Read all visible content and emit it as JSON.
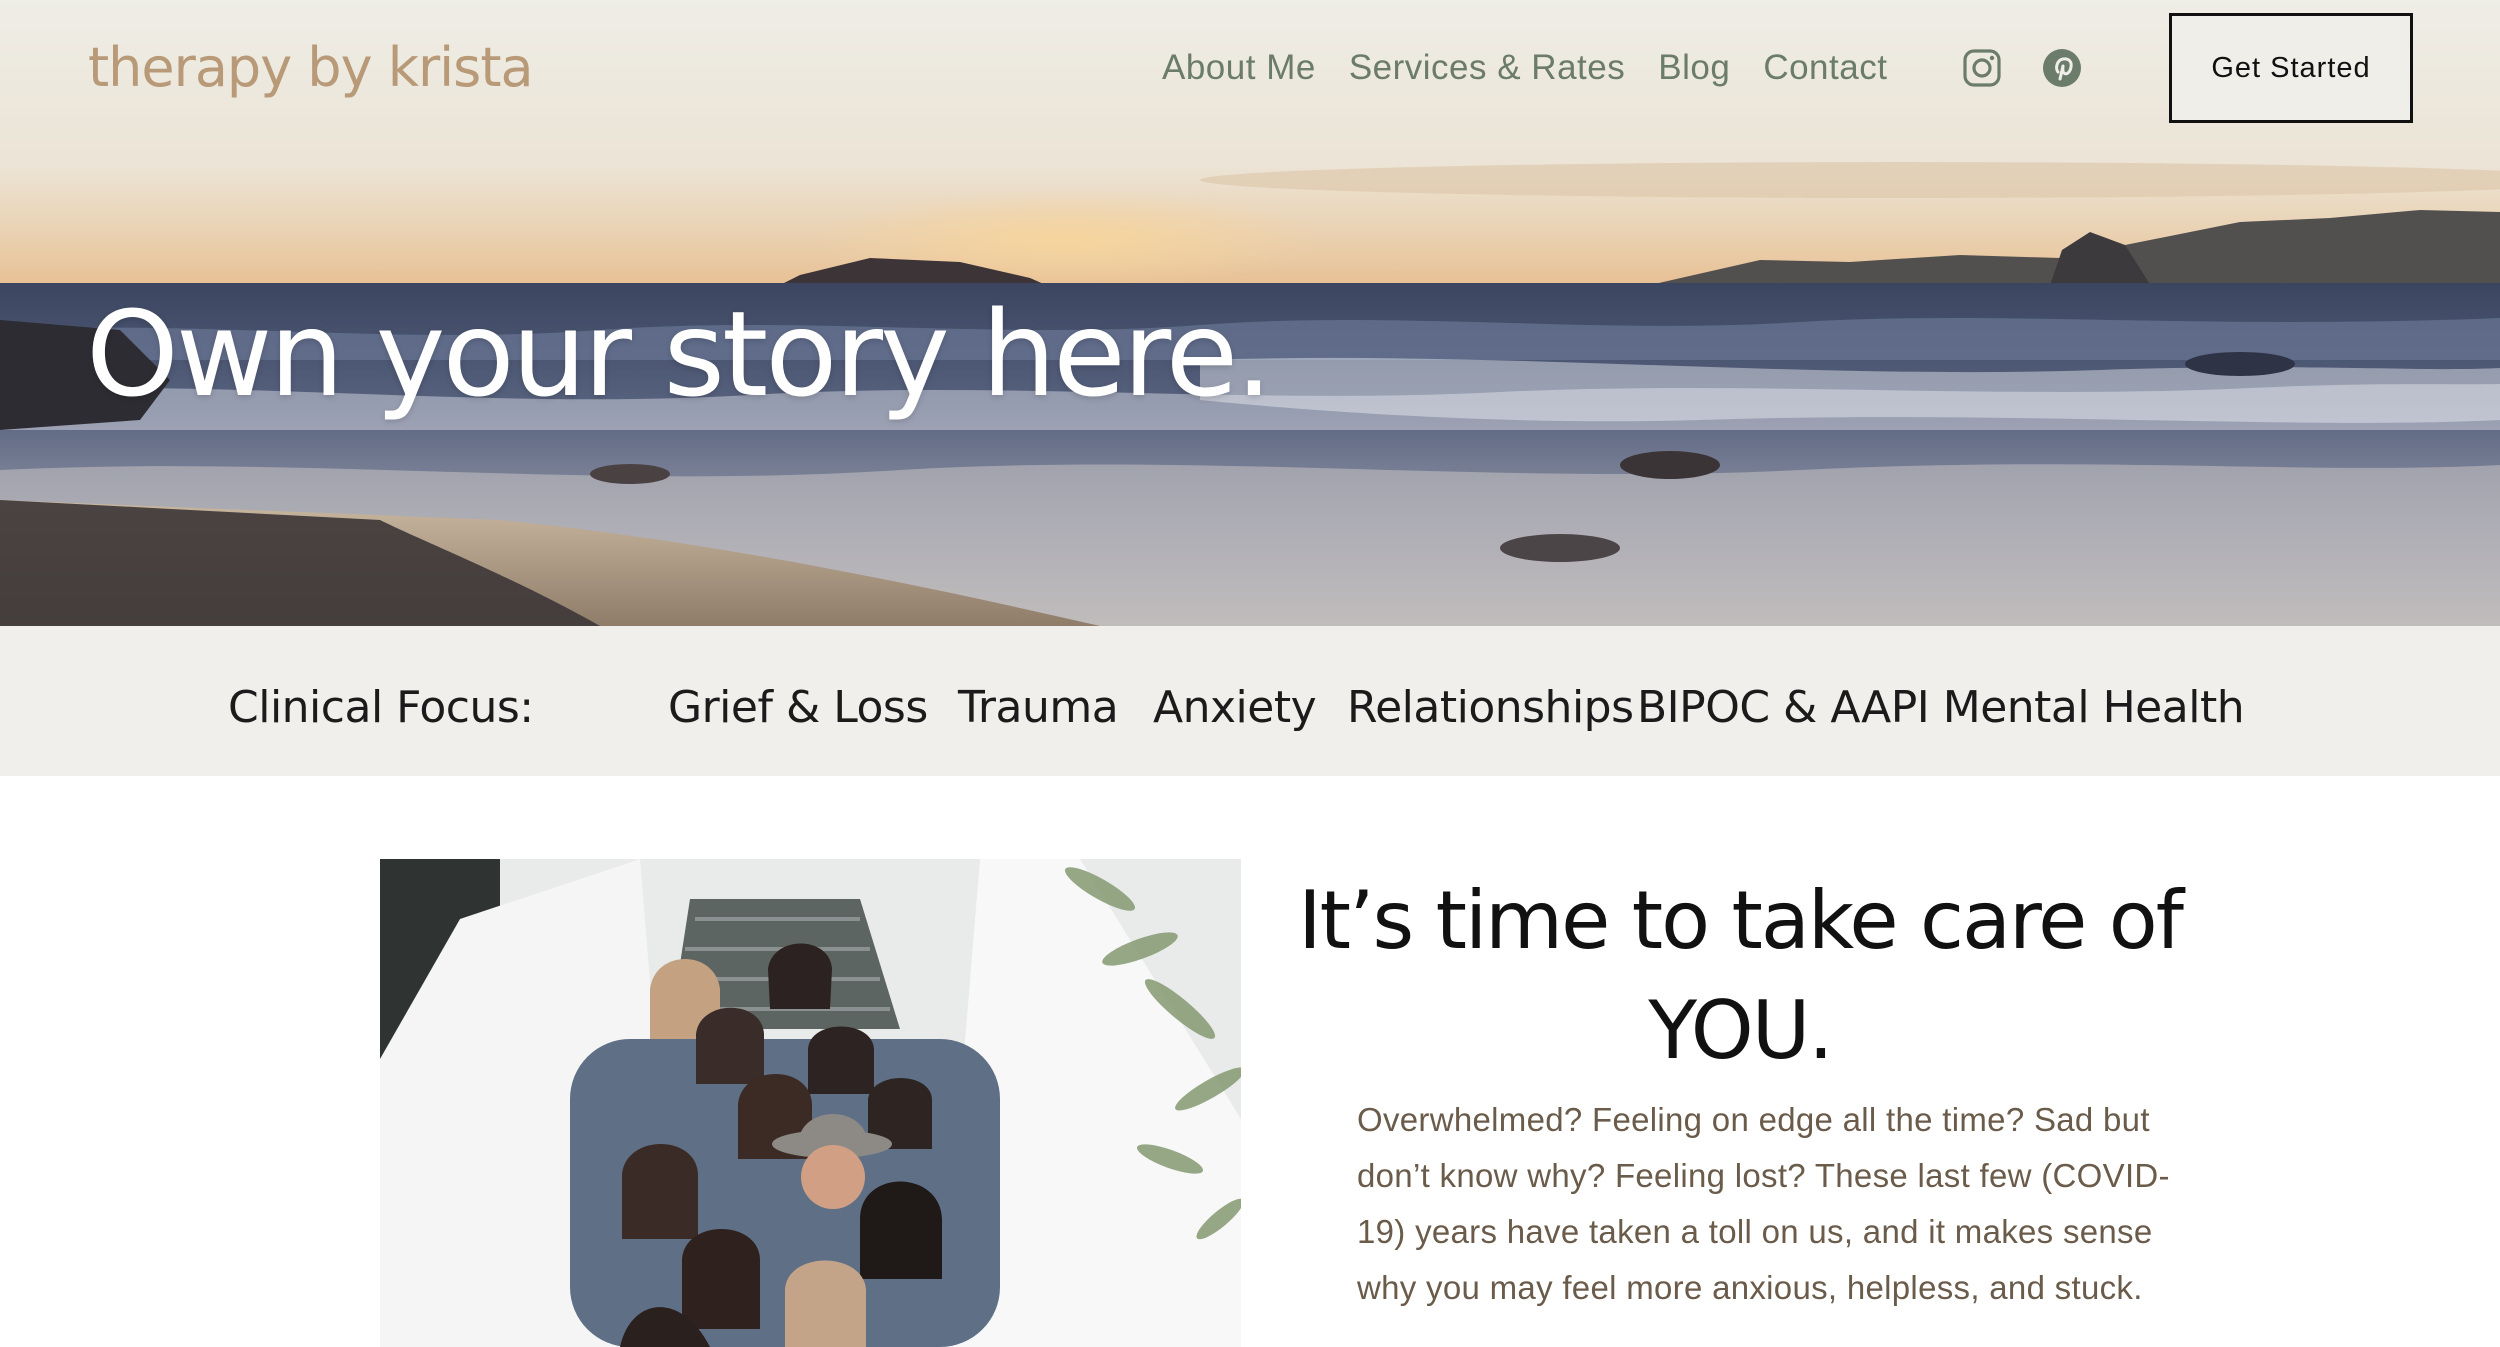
{
  "header": {
    "logo": "therapy by krista",
    "nav": [
      "About Me",
      "Services & Rates",
      "Blog",
      "Contact"
    ],
    "social": [
      "instagram-icon",
      "pinterest-icon"
    ],
    "cta": "Get Started"
  },
  "hero": {
    "title": "Own your story here."
  },
  "focus": {
    "label": "Clinical Focus:",
    "items": [
      "Grief & Loss",
      "Trauma",
      "Anxiety",
      "Relationships",
      "BIPOC & AAPI Mental Health"
    ]
  },
  "intro": {
    "heading_line1": "It’s time to take care of",
    "heading_line2": "YOU.",
    "paragraph": "Overwhelmed? Feeling on edge all the time? Sad but don’t know why?  Feeling lost? These last few (COVID-19) years have taken a toll on us, and it makes sense why you may feel more anxious, helpless, and stuck."
  },
  "colors": {
    "logo": "#b99a78",
    "nav": "#6b7c6a",
    "strip_bg": "#f0efec",
    "paragraph": "#6a5b4a"
  }
}
